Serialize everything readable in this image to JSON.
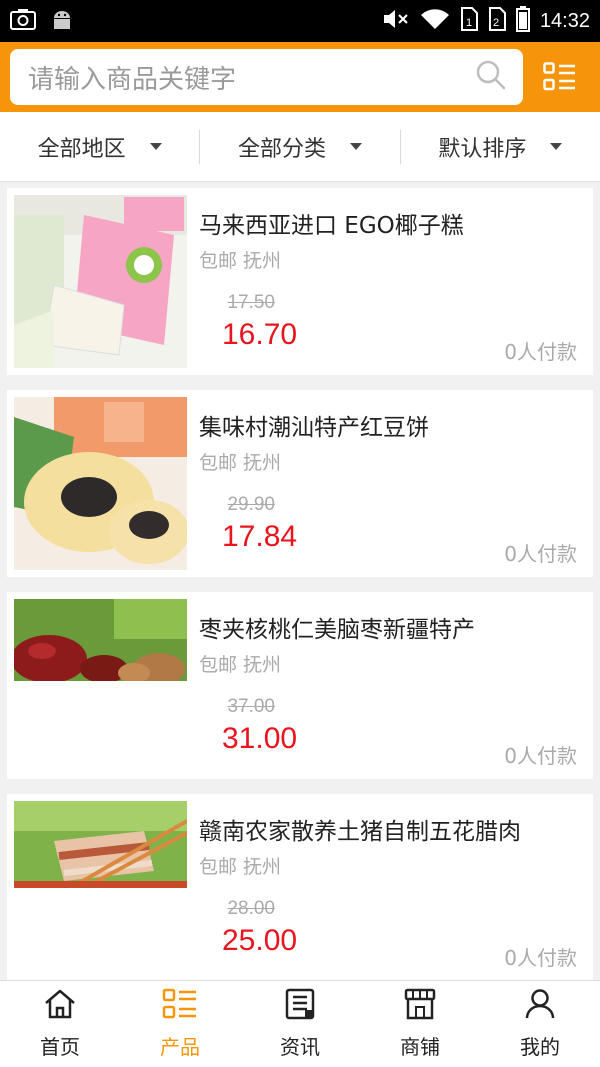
{
  "status_bar": {
    "time": "14:32",
    "icons": [
      "screenshot-icon",
      "android-icon",
      "mute-icon",
      "wifi-icon",
      "sim1-icon",
      "sim2-icon",
      "battery-icon"
    ]
  },
  "search": {
    "placeholder": "请输入商品关键字",
    "icon": "search-icon"
  },
  "header": {
    "menu_icon": "list-grid-icon",
    "accent_color": "#f7950a"
  },
  "filters": [
    {
      "label": "全部地区"
    },
    {
      "label": "全部分类"
    },
    {
      "label": "默认排序"
    }
  ],
  "products": [
    {
      "name": "马来西亚进口 EGO椰子糕",
      "meta": "包邮 抚州",
      "original_price": "17.50",
      "price": "16.70",
      "buyers": "0人付款",
      "image": "coconut-candy-image"
    },
    {
      "name": "集味村潮汕特产红豆饼",
      "meta": "包邮 抚州",
      "original_price": "29.90",
      "price": "17.84",
      "buyers": "0人付款",
      "image": "red-bean-cake-image"
    },
    {
      "name": "枣夹核桃仁美脑枣新疆特产",
      "meta": "包邮 抚州",
      "original_price": "37.00",
      "price": "31.00",
      "buyers": "0人付款",
      "image": "dates-walnut-image"
    },
    {
      "name": "赣南农家散养土猪自制五花腊肉",
      "meta": "包邮 抚州",
      "original_price": "28.00",
      "price": "25.00",
      "buyers": "0人付款",
      "image": "cured-pork-image"
    }
  ],
  "nav": [
    {
      "label": "首页",
      "icon": "home-icon",
      "active": false
    },
    {
      "label": "产品",
      "icon": "product-list-icon",
      "active": true
    },
    {
      "label": "资讯",
      "icon": "news-icon",
      "active": false
    },
    {
      "label": "商铺",
      "icon": "shop-icon",
      "active": false
    },
    {
      "label": "我的",
      "icon": "user-icon",
      "active": false
    }
  ],
  "colors": {
    "price": "#e8141e",
    "accent": "#f7950a"
  }
}
